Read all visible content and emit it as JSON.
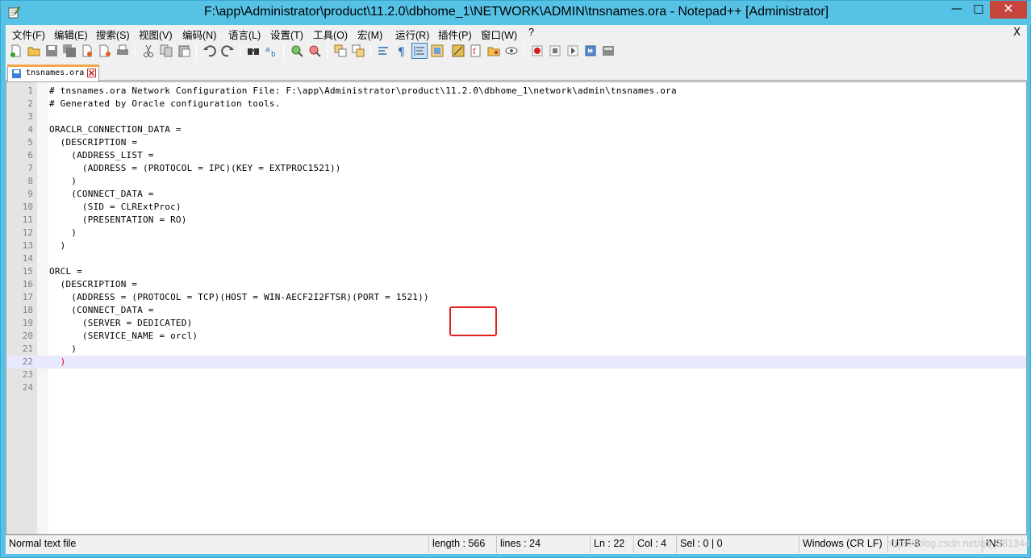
{
  "window": {
    "title": "F:\\app\\Administrator\\product\\11.2.0\\dbhome_1\\NETWORK\\ADMIN\\tnsnames.ora - Notepad++ [Administrator]",
    "min_glyph": "—",
    "max_glyph": "□",
    "close_glyph": "✕"
  },
  "menu": {
    "items": [
      "文件(F)",
      "编辑(E)",
      "搜索(S)",
      "视图(V)",
      "编码(N)",
      "语言(L)",
      "设置(T)",
      "工具(O)",
      "宏(M)",
      "运行(R)",
      "插件(P)",
      "窗口(W)",
      "?"
    ],
    "close_label": "X"
  },
  "tab": {
    "label": "tnsnames.ora"
  },
  "editor": {
    "current_line": 22,
    "lines": [
      {
        "n": "1",
        "text": "# tnsnames.ora Network Configuration File: F:\\app\\Administrator\\product\\11.2.0\\dbhome_1\\network\\admin\\tnsnames.ora"
      },
      {
        "n": "2",
        "text": "# Generated by Oracle configuration tools."
      },
      {
        "n": "3",
        "text": ""
      },
      {
        "n": "4",
        "text": "ORACLR_CONNECTION_DATA ="
      },
      {
        "n": "5",
        "text": "  (DESCRIPTION ="
      },
      {
        "n": "6",
        "text": "    (ADDRESS_LIST ="
      },
      {
        "n": "7",
        "text": "      (ADDRESS = (PROTOCOL = IPC)(KEY = EXTPROC1521))"
      },
      {
        "n": "8",
        "text": "    )"
      },
      {
        "n": "9",
        "text": "    (CONNECT_DATA ="
      },
      {
        "n": "10",
        "text": "      (SID = CLRExtProc)"
      },
      {
        "n": "11",
        "text": "      (PRESENTATION = RO)"
      },
      {
        "n": "12",
        "text": "    )"
      },
      {
        "n": "13",
        "text": "  )"
      },
      {
        "n": "14",
        "text": ""
      },
      {
        "n": "15",
        "text": "ORCL ="
      },
      {
        "n": "16",
        "text": "  (DESCRIPTION ="
      },
      {
        "n": "17",
        "text": "    (ADDRESS = (PROTOCOL = TCP)(HOST = WIN-AECF2I2FTSR)(PORT = 1521))"
      },
      {
        "n": "18",
        "text": "    (CONNECT_DATA ="
      },
      {
        "n": "19",
        "text": "      (SERVER = DEDICATED)"
      },
      {
        "n": "20",
        "text": "      (SERVICE_NAME = orcl)"
      },
      {
        "n": "21",
        "text": "    )"
      },
      {
        "n": "22",
        "text": "  )"
      },
      {
        "n": "23",
        "text": ""
      },
      {
        "n": "24",
        "text": ""
      }
    ]
  },
  "status": {
    "file_type": "Normal text file",
    "length": "length : 566",
    "lines": "lines : 24",
    "ln": "Ln : 22",
    "col": "Col : 4",
    "sel": "Sel : 0 | 0",
    "eol": "Windows (CR LF)",
    "encoding": "UTF-8",
    "mode": "INS",
    "watermark": "https://blog.csdn.net/qq_381344"
  }
}
